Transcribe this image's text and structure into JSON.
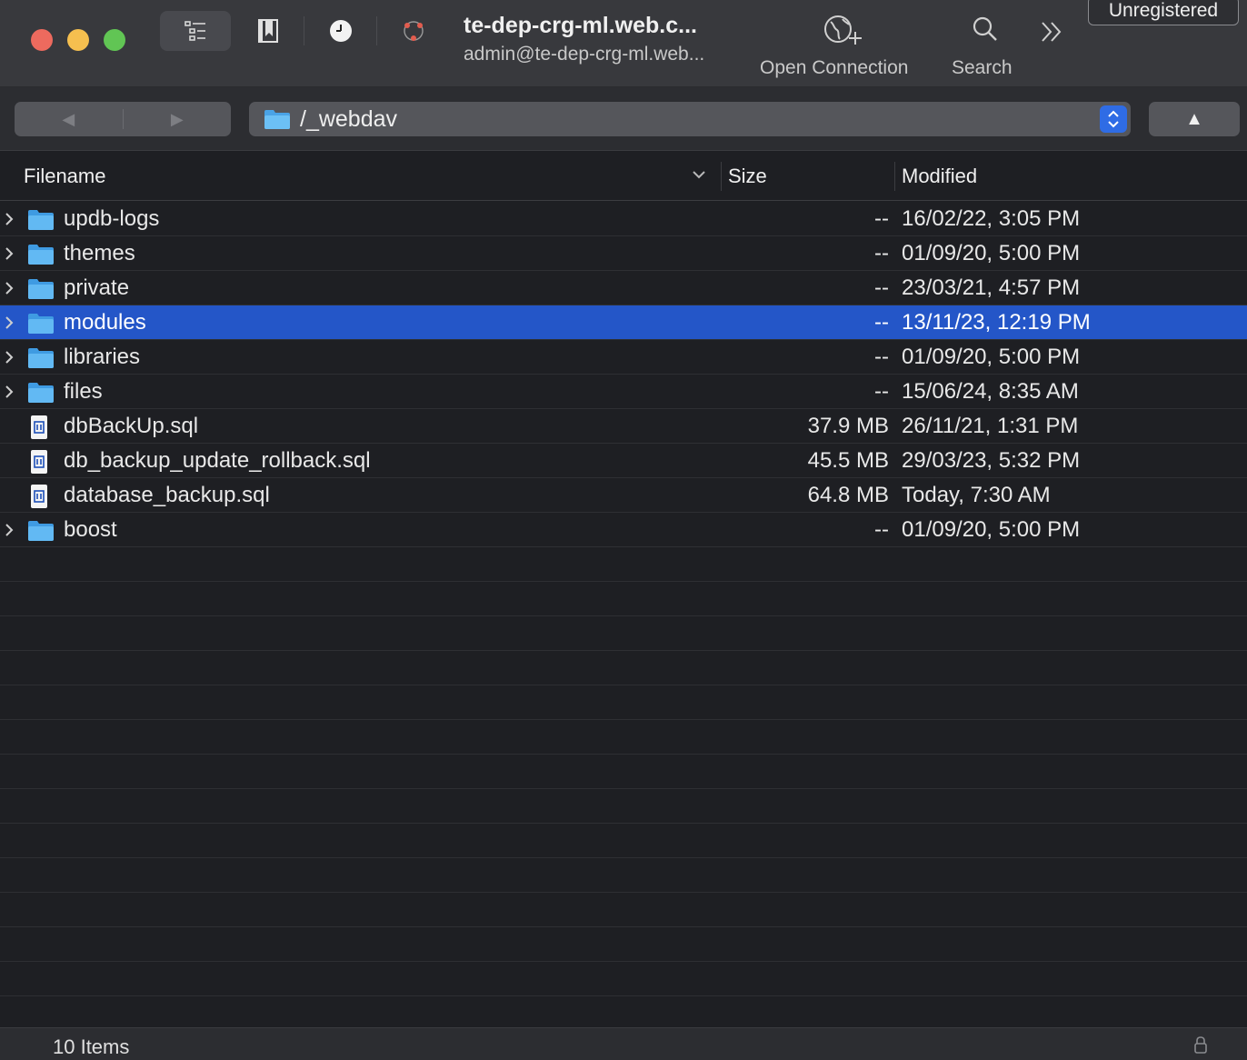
{
  "window": {
    "connection_title": "te-dep-crg-ml.web.c...",
    "connection_subtitle": "admin@te-dep-crg-ml.web..."
  },
  "toolbar": {
    "open_connection_label": "Open Connection",
    "search_label": "Search",
    "unregistered_label": "Unregistered",
    "more_icon": "chevrons-right-icon"
  },
  "pathbar": {
    "back_glyph": "◀",
    "forward_glyph": "▶",
    "path": "/_webdav",
    "up_glyph": "▲"
  },
  "columns": {
    "filename": "Filename",
    "size": "Size",
    "modified": "Modified"
  },
  "files": [
    {
      "name": "updb-logs",
      "type": "folder",
      "size": "--",
      "modified": "16/02/22, 3:05 PM",
      "selected": false
    },
    {
      "name": "themes",
      "type": "folder",
      "size": "--",
      "modified": "01/09/20, 5:00 PM",
      "selected": false
    },
    {
      "name": "private",
      "type": "folder",
      "size": "--",
      "modified": "23/03/21, 4:57 PM",
      "selected": false
    },
    {
      "name": "modules",
      "type": "folder",
      "size": "--",
      "modified": "13/11/23, 12:19 PM",
      "selected": true
    },
    {
      "name": "libraries",
      "type": "folder",
      "size": "--",
      "modified": "01/09/20, 5:00 PM",
      "selected": false
    },
    {
      "name": "files",
      "type": "folder",
      "size": "--",
      "modified": "15/06/24, 8:35 AM",
      "selected": false
    },
    {
      "name": "dbBackUp.sql",
      "type": "file",
      "size": "37.9 MB",
      "modified": "26/11/21, 1:31 PM",
      "selected": false
    },
    {
      "name": "db_backup_update_rollback.sql",
      "type": "file",
      "size": "45.5 MB",
      "modified": "29/03/23, 5:32 PM",
      "selected": false
    },
    {
      "name": "database_backup.sql",
      "type": "file",
      "size": "64.8 MB",
      "modified": "Today, 7:30 AM",
      "selected": false
    },
    {
      "name": "boost",
      "type": "folder",
      "size": "--",
      "modified": "01/09/20, 5:00 PM",
      "selected": false
    }
  ],
  "status": {
    "items_count": "10 Items"
  },
  "colors": {
    "selection": "#2456c8",
    "folder": "#5ab4ef",
    "accent": "#2f6ce5"
  }
}
